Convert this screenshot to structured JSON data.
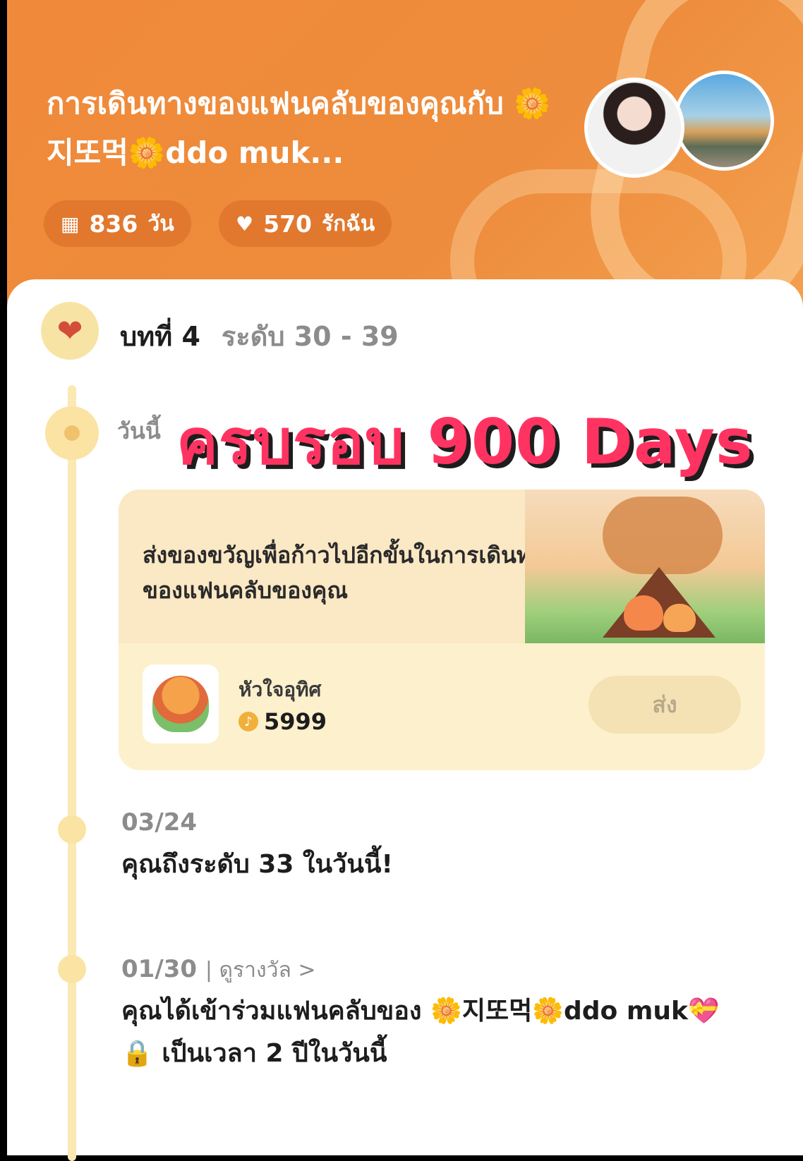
{
  "header": {
    "title": "การเดินทางของแฟนคลับของคุณกับ 🌼지또먹🌼ddo muk...",
    "days_value": "836",
    "days_unit": "วัน",
    "love_value": "570",
    "love_unit": "รักฉัน",
    "days_icon": "calendar-icon",
    "love_icon": "heart-icon"
  },
  "chapter": {
    "label": "บทที่ 4",
    "range": "ระดับ 30 - 39"
  },
  "today": {
    "label": "วันนี้",
    "overlay": "ครบรอบ 900 Days"
  },
  "gift_card": {
    "description": "ส่งของขวัญเพื่อก้าวไปอีกขั้นในการเดินทางของแฟนคลับของคุณ",
    "gift_name": "หัวใจอุทิศ",
    "price": "5999",
    "send_label": "ส่ง"
  },
  "entries": [
    {
      "date": "03/24",
      "text": "คุณถึงระดับ 33 ในวันนี้!"
    },
    {
      "date": "01/30",
      "link": "| ดูรางวัล >",
      "text": "คุณได้เข้าร่วมแฟนคลับของ 🌼지또먹🌼ddo muk💝 🔒 เป็นเวลา 2 ปีในวันนี้"
    }
  ],
  "colors": {
    "header_orange": "#ed8c3c",
    "overlay_pink": "#ff3361",
    "timeline_yellow": "#fbe9b3"
  }
}
